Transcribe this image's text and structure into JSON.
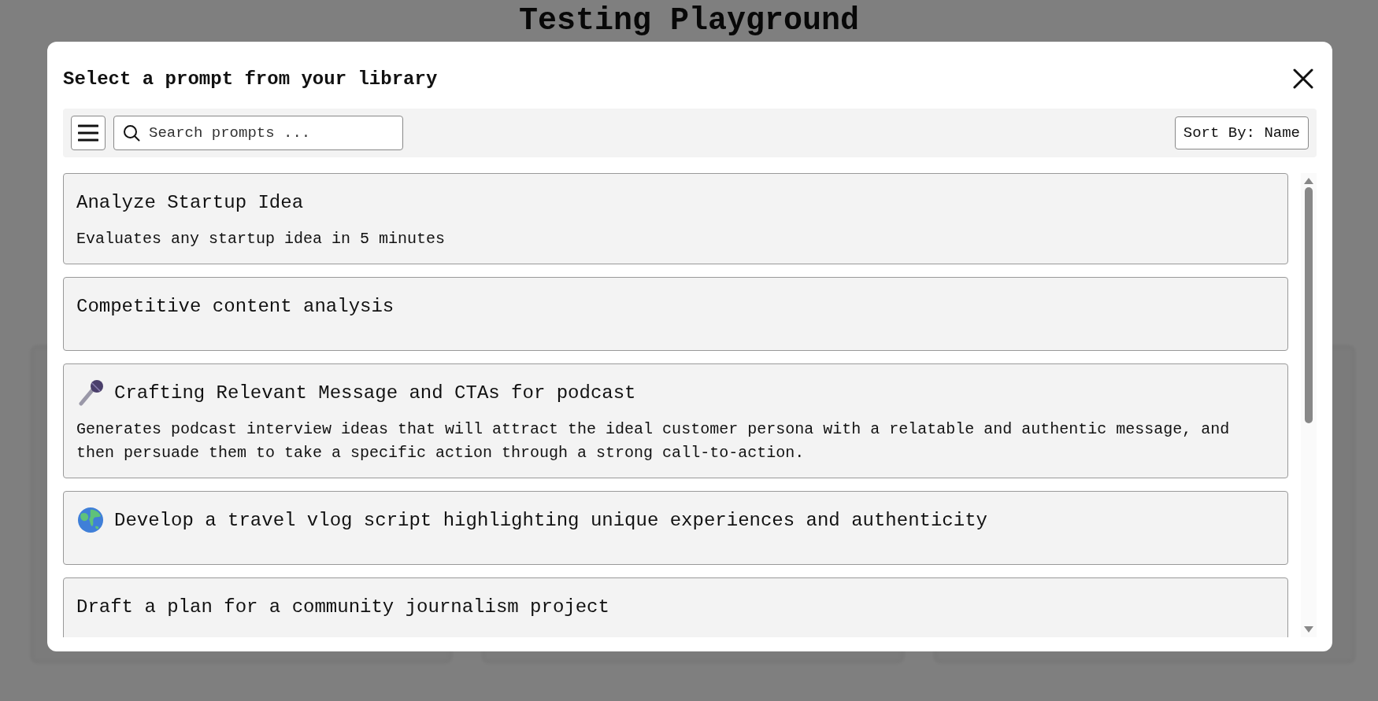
{
  "page": {
    "title": "Testing Playground"
  },
  "modal": {
    "title": "Select a prompt from your library",
    "search": {
      "placeholder": "Search prompts ..."
    },
    "sort_button": "Sort By: Name",
    "prompts": [
      {
        "kind": "plain",
        "title": "Analyze Startup Idea",
        "description": "Evaluates any startup idea in 5 minutes"
      },
      {
        "kind": "plain",
        "title": "Competitive content analysis"
      },
      {
        "kind": "microphone",
        "title": "Crafting Relevant Message and CTAs for podcast",
        "description": "Generates podcast interview ideas that will attract the ideal customer persona with a relatable and authentic message, and then persuade them to take a specific action through a strong call-to-action."
      },
      {
        "kind": "globe",
        "title": "Develop a travel vlog script highlighting unique experiences and authenticity"
      },
      {
        "kind": "plain",
        "title": "Draft a plan for a community journalism project"
      }
    ]
  }
}
